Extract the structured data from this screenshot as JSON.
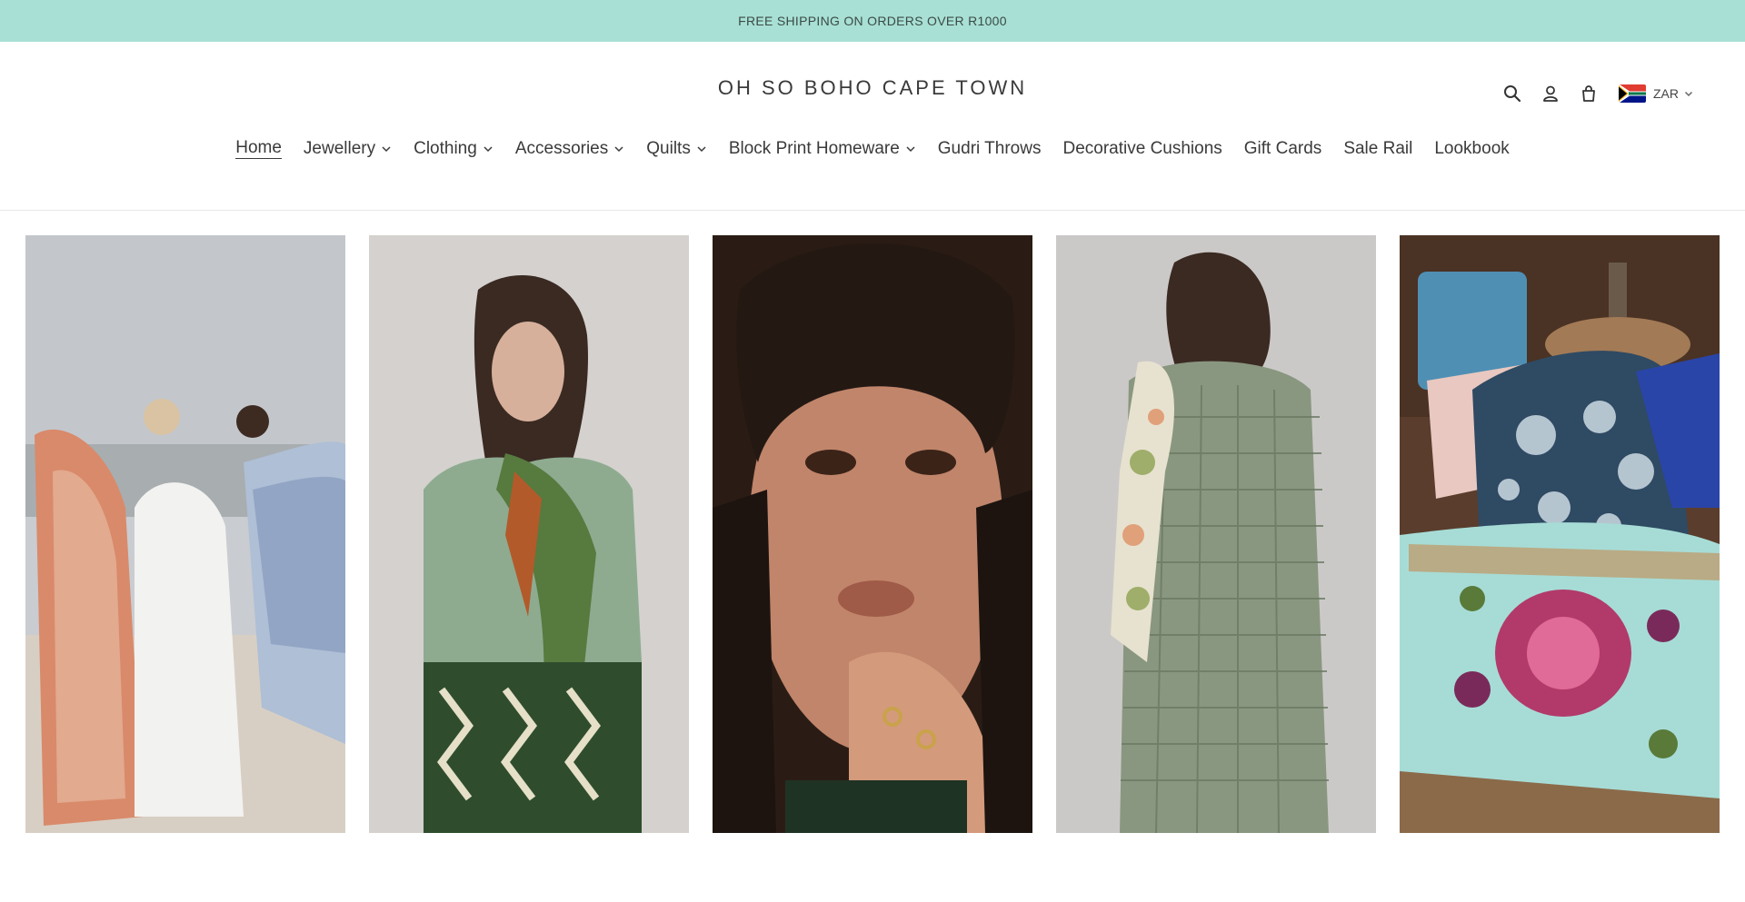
{
  "announcement": {
    "text": "FREE SHIPPING ON ORDERS OVER R1000"
  },
  "header": {
    "brand": "OH SO BOHO CAPE TOWN",
    "icons": {
      "search": "search-icon",
      "account": "user-icon",
      "cart": "cart-icon"
    },
    "currency": {
      "code": "ZAR",
      "flag": "south-africa-flag-icon"
    }
  },
  "nav": {
    "items": [
      {
        "label": "Home",
        "active": true,
        "dropdown": false
      },
      {
        "label": "Jewellery",
        "dropdown": true
      },
      {
        "label": "Clothing",
        "dropdown": true
      },
      {
        "label": "Accessories",
        "dropdown": true
      },
      {
        "label": "Quilts",
        "dropdown": true
      },
      {
        "label": "Block Print Homeware",
        "dropdown": true
      },
      {
        "label": "Gudri Throws",
        "dropdown": false
      },
      {
        "label": "Decorative Cushions",
        "dropdown": false
      },
      {
        "label": "Gift Cards",
        "dropdown": false
      },
      {
        "label": "Sale Rail",
        "dropdown": false
      },
      {
        "label": "Lookbook",
        "dropdown": false
      }
    ]
  },
  "colors": {
    "announcement_bg": "#a8e0d5",
    "text": "#3a3a3a",
    "divider": "#e8e8e8"
  }
}
